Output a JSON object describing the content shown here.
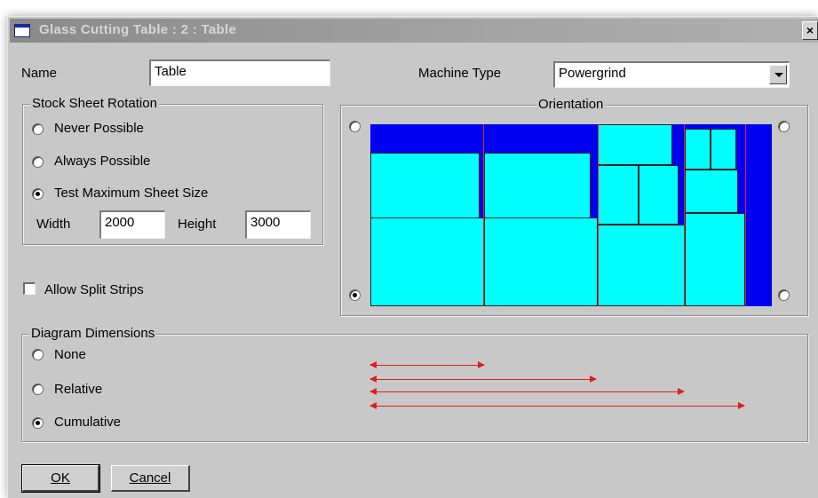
{
  "window": {
    "title": "Glass Cutting Table  : 2 : Table",
    "close_glyph": "×"
  },
  "name_field": {
    "label": "Name",
    "value": "Table"
  },
  "machine_type": {
    "label": "Machine Type",
    "value": "Powergrind"
  },
  "stock_sheet_rotation": {
    "title": "Stock Sheet Rotation",
    "options": [
      "Never Possible",
      "Always Possible",
      "Test Maximum Sheet Size"
    ],
    "selected": "Test Maximum Sheet Size",
    "width_label": "Width",
    "width_value": "2000",
    "height_label": "Height",
    "height_value": "3000"
  },
  "allow_split_strips": {
    "label": "Allow Split Strips",
    "checked": false
  },
  "orientation": {
    "title": "Orientation",
    "selected_corner": "bottom-left"
  },
  "diagram_colors": {
    "stock": "#0000f0",
    "piece": "#00ffff",
    "cut": "#e02020"
  },
  "diagram_dimensions": {
    "title": "Diagram Dimensions",
    "options": [
      "None",
      "Relative",
      "Cumulative"
    ],
    "selected": "Cumulative"
  },
  "buttons": {
    "ok": {
      "label": "OK"
    },
    "cancel": {
      "label": "Cancel"
    }
  }
}
